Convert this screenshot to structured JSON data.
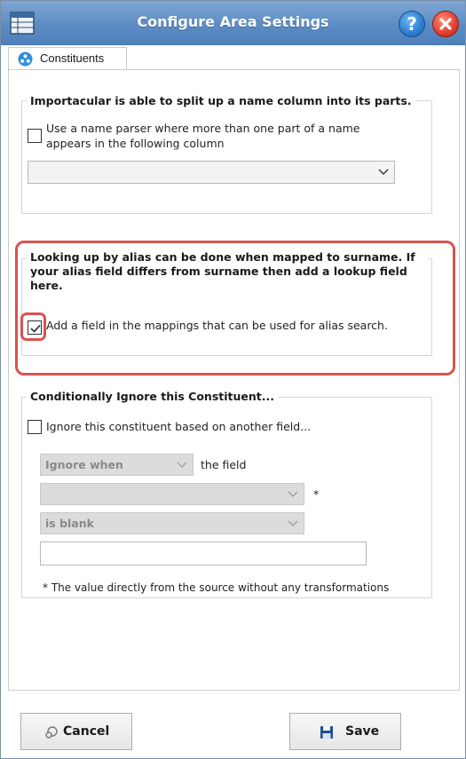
{
  "window": {
    "title": "Configure Area Settings",
    "icons": {
      "app": "table-grid-icon",
      "help": "help-icon",
      "close": "close-icon"
    },
    "help_glyph": "?"
  },
  "tabs": [
    {
      "label": "Constituents",
      "icon": "constituents-icon",
      "selected": true
    }
  ],
  "name_parser": {
    "legend": "Importacular is able to split up a name column into its parts.",
    "checkbox_label": "Use a name parser where more than one part of a name appears in the following column",
    "checked": false,
    "column_select_value": ""
  },
  "alias": {
    "legend": "Looking up by alias can be done when mapped to surname. If your alias field differs from surname then add a lookup field here.",
    "checkbox_label": "Add a field in the mappings that can be used for alias search.",
    "checked": true
  },
  "conditional_ignore": {
    "legend": "Conditionally Ignore this Constituent...",
    "checkbox_label": "Ignore this constituent based on another field...",
    "checked": false,
    "condition_select_value": "Ignore when",
    "the_field_label": "the field",
    "field_select_value": "",
    "asterisk": "*",
    "operator_select_value": "is blank",
    "value_input": "",
    "footnote": "* The value directly from the source without any transformations"
  },
  "buttons": {
    "cancel_label": "Cancel",
    "cancel_icon": "cancel-icon",
    "save_label": "Save",
    "save_icon": "save-disk-icon"
  },
  "colors": {
    "titlebar": "#5d8cc4",
    "highlight": "#d9534f",
    "checkmark": "#3a3a3a"
  }
}
